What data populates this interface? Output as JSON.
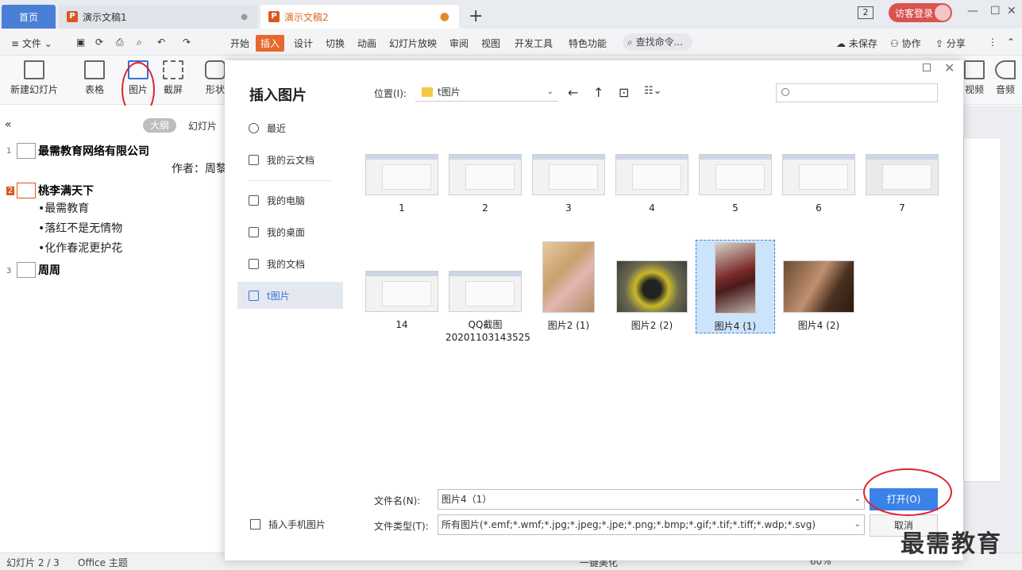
{
  "tabs": {
    "home": "首页",
    "doc1": "演示文稿1",
    "doc2": "演示文稿2",
    "window_count": "2",
    "login": "访客登录"
  },
  "menubar": {
    "file": "文件",
    "items": [
      "开始",
      "插入",
      "设计",
      "切换",
      "动画",
      "幻灯片放映",
      "审阅",
      "视图",
      "开发工具",
      "特色功能"
    ],
    "search": "查找命令...",
    "unsaved": "未保存",
    "collab": "协作",
    "share": "分享"
  },
  "ribbon": {
    "new_slide": "新建幻灯片",
    "table": "表格",
    "picture": "图片",
    "screenshot": "截屏",
    "shape": "形状",
    "video": "视频",
    "audio": "音频"
  },
  "outline": {
    "tab_outline": "大纲",
    "tab_slides": "幻灯片",
    "slide1_title": "最需教育网络有限公司",
    "slide1_author": "作者：周黎",
    "slide2_title": "桃李满天下",
    "slide2_bullets": [
      "•最需教育",
      "•落红不是无情物",
      "•化作春泥更护花"
    ],
    "slide3_title": "周周"
  },
  "status": {
    "slide_count": "幻灯片 2 / 3",
    "theme": "Office 主题",
    "beautify": "一键美化",
    "zoom": "60%"
  },
  "dialog": {
    "title": "插入图片",
    "side": [
      "最近",
      "我的云文档",
      "我的电脑",
      "我的桌面",
      "我的文档",
      "t图片"
    ],
    "location_label": "位置(I):",
    "location_value": "t图片",
    "files": [
      {
        "name": "1"
      },
      {
        "name": "2"
      },
      {
        "name": "3"
      },
      {
        "name": "4"
      },
      {
        "name": "5"
      },
      {
        "name": "6"
      },
      {
        "name": "7"
      },
      {
        "name": "14"
      },
      {
        "name": "QQ截图 20201103143525"
      },
      {
        "name": "图片2 (1)"
      },
      {
        "name": "图片2 (2)"
      },
      {
        "name": "图片4 (1)"
      },
      {
        "name": "图片4 (2)"
      }
    ],
    "filename_label": "文件名(N):",
    "filename_value": "图片4（1）",
    "filetype_label": "文件类型(T):",
    "filetype_value": "所有图片(*.emf;*.wmf;*.jpg;*.jpeg;*.jpe;*.png;*.bmp;*.gif;*.tif;*.tiff;*.wdp;*.svg)",
    "open_btn": "打开(O)",
    "cancel_btn": "取消",
    "phone_link": "插入手机图片",
    "selected_index": 11
  },
  "watermark": "最需教育",
  "colors": {
    "accent": "#3b82e8",
    "insert_tab": "#e8672d",
    "annotation": "#e0232f"
  }
}
